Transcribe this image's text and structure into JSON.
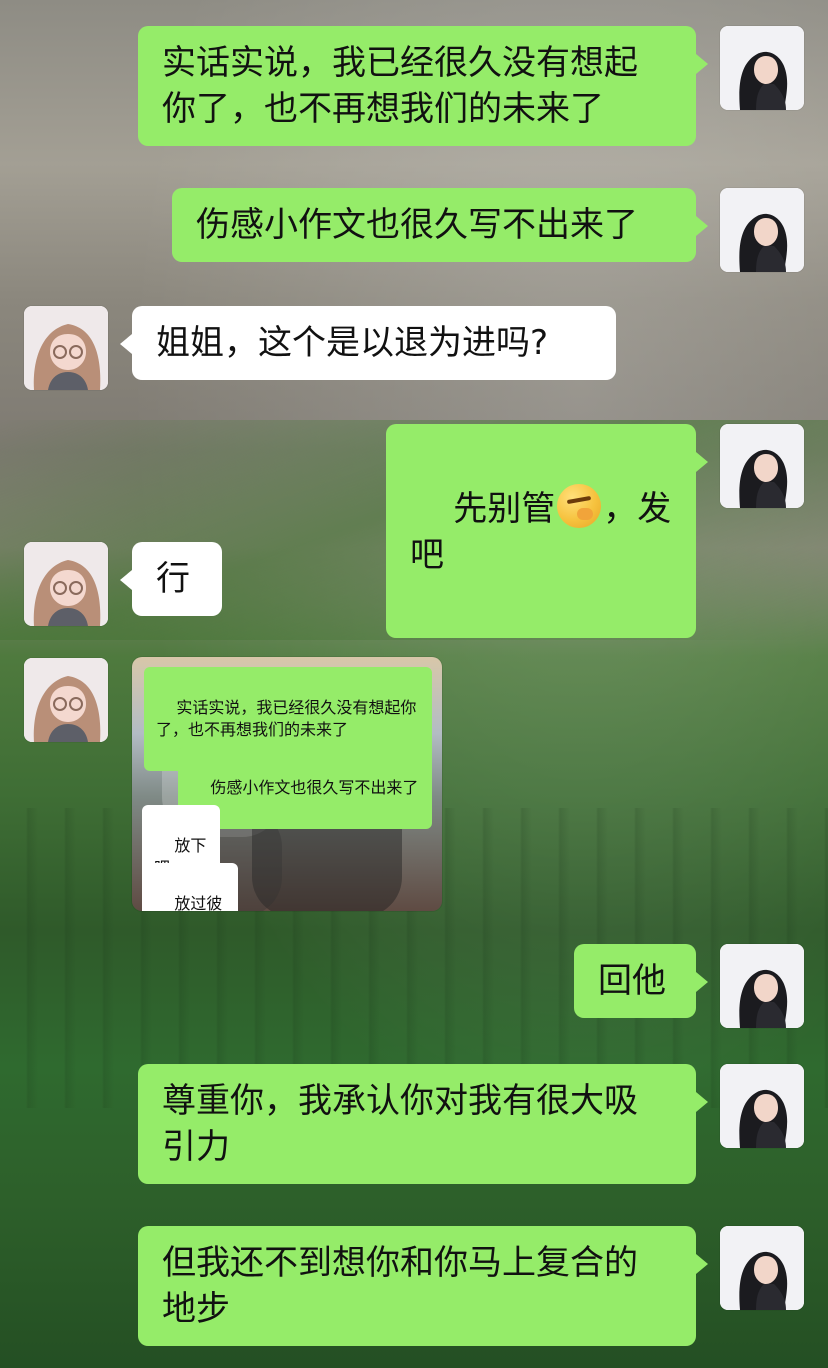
{
  "theme": {
    "bubble_me": "#95ec69",
    "bubble_other": "#ffffff"
  },
  "chat": {
    "messages": [
      {
        "id": "m1",
        "sender": "me",
        "type": "text",
        "text": "实话实说，我已经很久没有想起\n你了，也不再想我们的未来了"
      },
      {
        "id": "m2",
        "sender": "me",
        "type": "text",
        "text": "伤感小作文也很久写不出来了"
      },
      {
        "id": "m3",
        "sender": "other",
        "type": "text",
        "text": "姐姐，这个是以退为进吗?"
      },
      {
        "id": "m4",
        "sender": "me",
        "type": "text",
        "text_before": "先别管",
        "emoji": "thinking-face-emoji",
        "text_after": "，发吧"
      },
      {
        "id": "m5",
        "sender": "other",
        "type": "text",
        "text": "行"
      },
      {
        "id": "m6",
        "sender": "other",
        "type": "image",
        "mini_messages": [
          {
            "sender": "me",
            "text": "实话实说，我已经很久没有想起你\n了，也不再想我们的未来了"
          },
          {
            "sender": "me",
            "text": "伤感小作文也很久写不出来了"
          },
          {
            "sender": "other",
            "text": "放下吧"
          },
          {
            "sender": "other",
            "text": "放过彼此"
          }
        ]
      },
      {
        "id": "m7",
        "sender": "me",
        "type": "text",
        "text": "回他"
      },
      {
        "id": "m8",
        "sender": "me",
        "type": "text",
        "text": "尊重你，我承认你对我有很大吸\n引力"
      },
      {
        "id": "m9",
        "sender": "me",
        "type": "text",
        "text": "但我还不到想你和你马上复合的\n地步"
      }
    ]
  }
}
